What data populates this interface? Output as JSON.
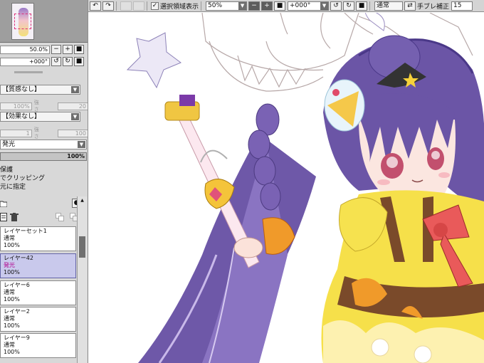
{
  "navigator": {
    "zoom": "50.0%",
    "rotation": "+000°"
  },
  "texture": {
    "label": "【質感なし】",
    "value": "100%",
    "strength_label": "強さ",
    "strength_value": "20"
  },
  "effect": {
    "label": "【効果なし】",
    "value": "1",
    "strength_label": "強さ",
    "strength_value": "100"
  },
  "blend": {
    "mode": "発光",
    "opacity": "100%"
  },
  "options": {
    "protect": "保護",
    "clipping": "でクリッピング",
    "designate": "元に指定"
  },
  "layers": [
    {
      "name": "レイヤーセット1",
      "mode": "通常",
      "opacity": "100%",
      "selected": false
    },
    {
      "name": "レイヤー42",
      "mode": "発光",
      "opacity": "100%",
      "selected": true
    },
    {
      "name": "レイヤー6",
      "mode": "通常",
      "opacity": "100%",
      "selected": false
    },
    {
      "name": "レイヤー2",
      "mode": "通常",
      "opacity": "100%",
      "selected": false
    },
    {
      "name": "レイヤー9",
      "mode": "通常",
      "opacity": "100%",
      "selected": false
    }
  ],
  "toolbar": {
    "selection_source": "選択領域表示",
    "zoom": "50%",
    "rotation": "+000°",
    "blend_mode": "通常",
    "stabilizer_label": "手ブレ補正",
    "stabilizer_value": "15"
  },
  "colors": {
    "panel_bg": "#d8d8d8",
    "selected_layer": "#c9c9ec",
    "hair": "#6e58a8",
    "dress": "#f6e04a",
    "ribbon": "#e95a5a",
    "accent_orange": "#f09a2a"
  }
}
